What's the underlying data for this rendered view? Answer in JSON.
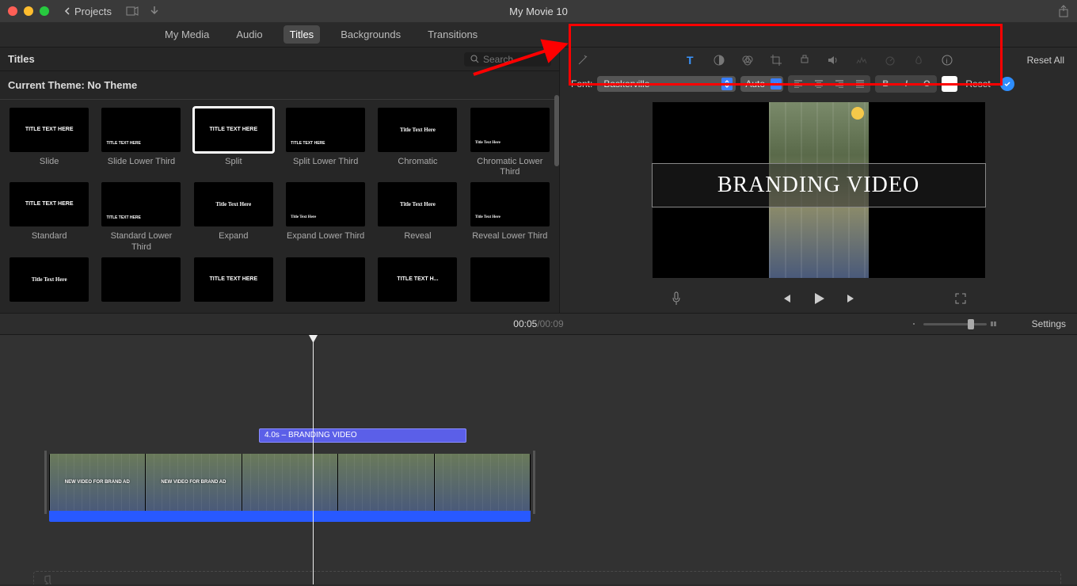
{
  "titlebar": {
    "projects_label": "Projects",
    "movie_title": "My Movie 10"
  },
  "tabs": {
    "my_media": "My Media",
    "audio": "Audio",
    "titles": "Titles",
    "backgrounds": "Backgrounds",
    "transitions": "Transitions"
  },
  "browser": {
    "header": "Titles",
    "search_placeholder": "Search",
    "theme_label": "Current Theme: No Theme",
    "items": [
      {
        "label": "Slide",
        "thumb": "TITLE TEXT HERE"
      },
      {
        "label": "Slide Lower Third",
        "thumb": "TITLE TEXT HERE"
      },
      {
        "label": "Split",
        "thumb": "TITLE TEXT HERE"
      },
      {
        "label": "Split Lower Third",
        "thumb": "TITLE TEXT HERE"
      },
      {
        "label": "Chromatic",
        "thumb": "Title Text Here"
      },
      {
        "label": "Chromatic Lower Third",
        "thumb": "Title Text Here"
      },
      {
        "label": "Standard",
        "thumb": "TITLE TEXT HERE"
      },
      {
        "label": "Standard Lower Third",
        "thumb": "TITLE TEXT HERE"
      },
      {
        "label": "Expand",
        "thumb": "Title Text Here"
      },
      {
        "label": "Expand Lower Third",
        "thumb": "Title Text Here"
      },
      {
        "label": "Reveal",
        "thumb": "Title Text Here"
      },
      {
        "label": "Reveal Lower Third",
        "thumb": "Title Text Here"
      },
      {
        "label": "",
        "thumb": "Title Text Here"
      },
      {
        "label": "",
        "thumb": ""
      },
      {
        "label": "",
        "thumb": "TITLE TEXT HERE"
      },
      {
        "label": "",
        "thumb": ""
      },
      {
        "label": "",
        "thumb": "TITLE TEXT H..."
      },
      {
        "label": "",
        "thumb": ""
      }
    ]
  },
  "inspector": {
    "reset_all": "Reset All",
    "font_label": "Font:",
    "font_value": "Baskerville",
    "size_value": "Auto",
    "style_bold": "B",
    "style_italic": "I",
    "style_outline": "O",
    "color": "#ffffff",
    "reset": "Reset"
  },
  "viewer": {
    "title_text": "BRANDING VIDEO"
  },
  "timecode": {
    "current": "00:05",
    "separator": " / ",
    "total": "00:09",
    "settings": "Settings"
  },
  "timeline": {
    "title_clip": "4.0s – BRANDING VIDEO",
    "frame_text_a": "NEW VIDEO FOR BRAND AD",
    "frame_text_b": "NEW VIDEO FOR BRAND AD"
  }
}
